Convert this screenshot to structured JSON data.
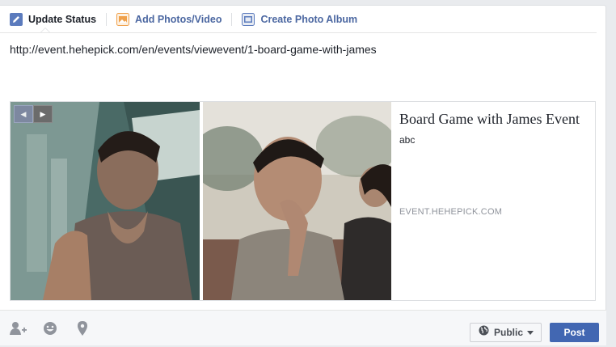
{
  "tabs": [
    {
      "label": "Update Status",
      "icon": "pencil-icon",
      "active": true
    },
    {
      "label": "Add Photos/Video",
      "icon": "photo-icon",
      "active": false
    },
    {
      "label": "Create Photo Album",
      "icon": "album-icon",
      "active": false
    }
  ],
  "status_text": "http://event.hehepick.com/en/events/viewevent/1-board-game-with-james",
  "link_preview": {
    "title": "Board Game with James Event",
    "description": "abc",
    "domain": "EVENT.HEHEPICK.COM",
    "nav": {
      "prev_icon": "triangle-left-icon",
      "next_icon": "triangle-right-icon"
    }
  },
  "footer": {
    "icons": [
      "tag-people-icon",
      "emoji-icon",
      "location-icon"
    ],
    "privacy_label": "Public",
    "privacy_icon": "globe-icon",
    "post_label": "Post"
  },
  "colors": {
    "link_blue": "#4b67a1",
    "post_button": "#4267b2",
    "photo_tab_icon": "#f0a14b"
  }
}
